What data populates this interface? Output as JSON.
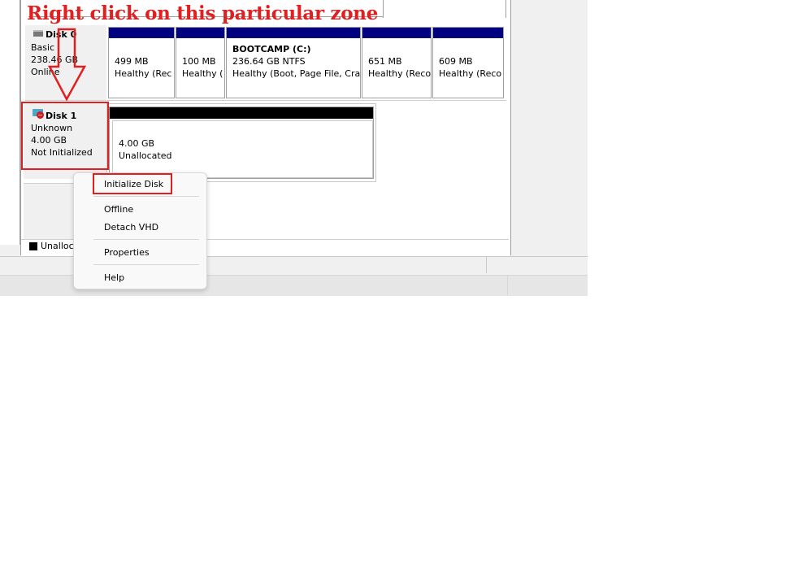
{
  "annotation": {
    "title": "Right click on this particular zone"
  },
  "disks": [
    {
      "name": "Disk 0",
      "type": "Basic",
      "size": "238.46 GB",
      "status": "Online",
      "partitions": [
        {
          "name": "",
          "size": "499 MB",
          "status": "Healthy (Rec"
        },
        {
          "name": "",
          "size": "100 MB",
          "status": "Healthy ("
        },
        {
          "name": "BOOTCAMP  (C:)",
          "size": "236.64 GB NTFS",
          "status": "Healthy (Boot, Page File, Cra"
        },
        {
          "name": "",
          "size": "651 MB",
          "status": "Healthy (Reco"
        },
        {
          "name": "",
          "size": "609 MB",
          "status": "Healthy (Reco"
        }
      ]
    },
    {
      "name": "Disk 1",
      "type": "Unknown",
      "size": "4.00 GB",
      "status": "Not Initialized",
      "partitions": [
        {
          "name": "",
          "size": "4.00 GB",
          "status": "Unallocated"
        }
      ]
    }
  ],
  "legend": {
    "label": "Unalloc"
  },
  "context_menu": {
    "items": [
      "Initialize Disk",
      "Offline",
      "Detach VHD",
      "Properties",
      "Help"
    ]
  },
  "colors": {
    "annotation": "#e02020",
    "partition_bar": "#000080",
    "unallocated_bar": "#000000"
  }
}
